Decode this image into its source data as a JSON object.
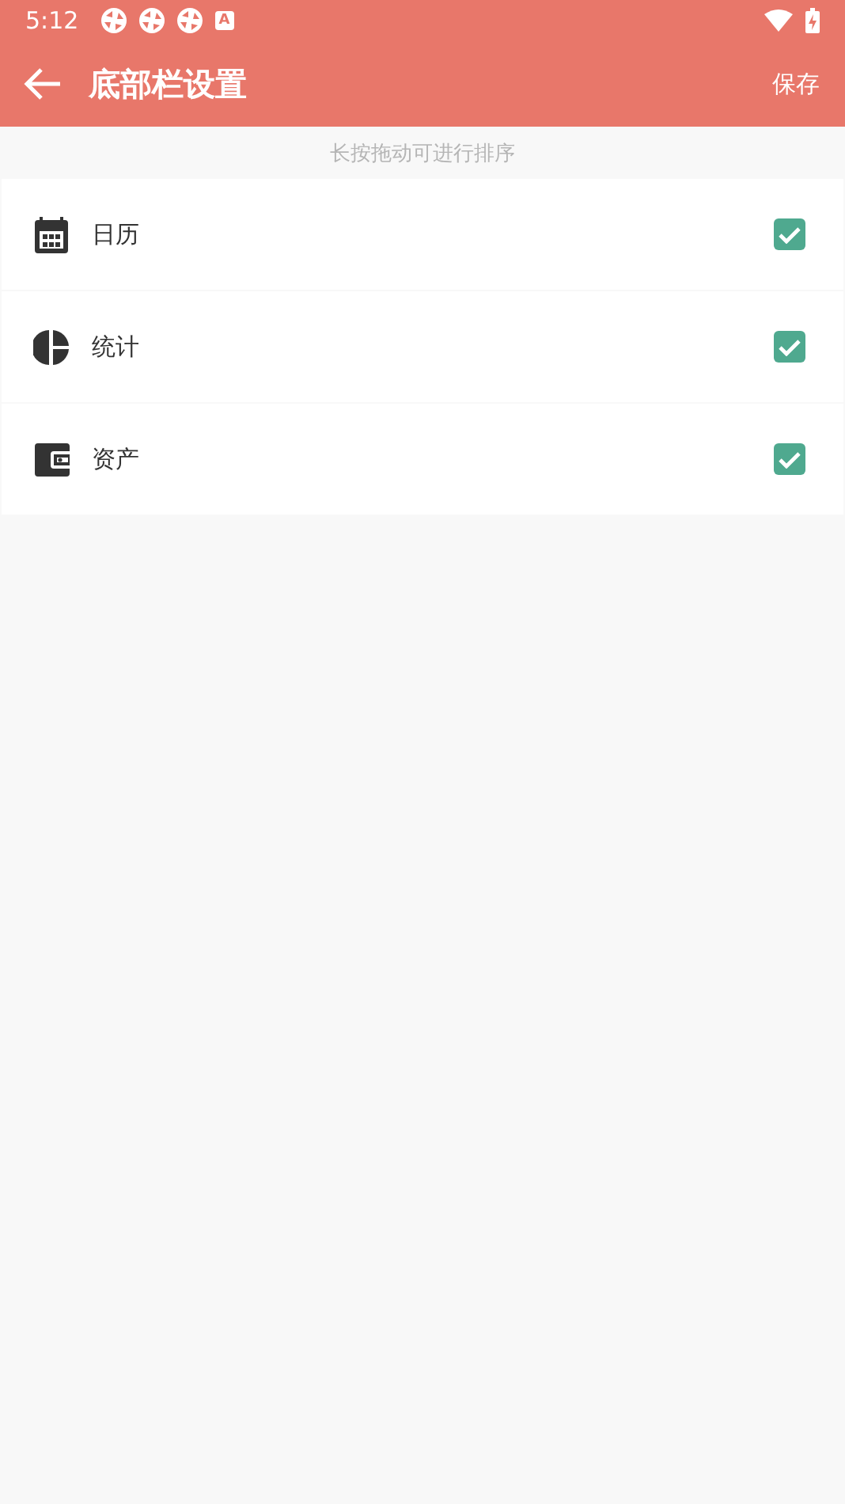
{
  "status_bar": {
    "time": "5:12",
    "notification_icons": [
      {
        "kind": "app"
      },
      {
        "kind": "app"
      },
      {
        "kind": "app"
      },
      {
        "kind": "letter",
        "text": "A"
      }
    ]
  },
  "app_bar": {
    "title": "底部栏设置",
    "action": "保存"
  },
  "hint": "长按拖动可进行排序",
  "items": [
    {
      "label": "日历",
      "kind": "calendar",
      "checked": true
    },
    {
      "label": "统计",
      "kind": "chart",
      "checked": true
    },
    {
      "label": "资产",
      "kind": "wallet",
      "checked": true
    }
  ]
}
